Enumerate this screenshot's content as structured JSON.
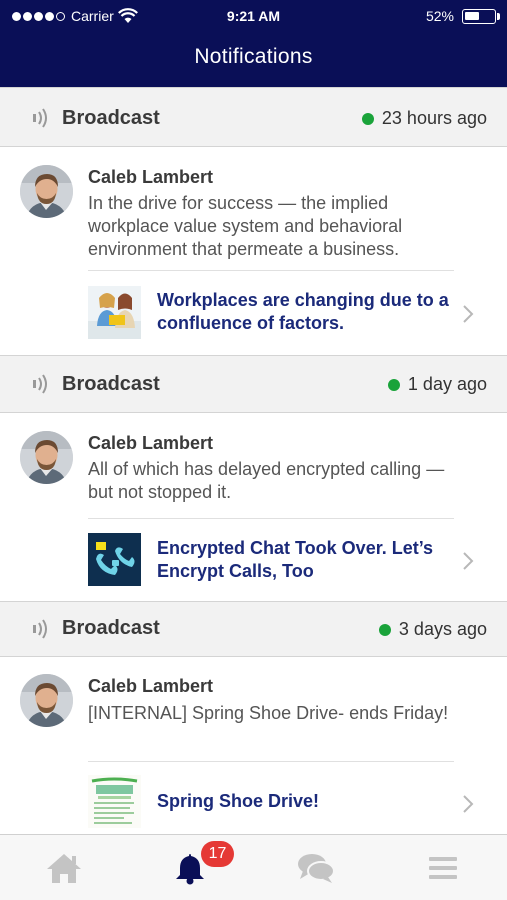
{
  "status_bar": {
    "carrier": "Carrier",
    "time": "9:21 AM",
    "battery_percent": "52%",
    "battery_level": 0.52,
    "signal_bars_filled": 4,
    "signal_bars_total": 5
  },
  "header": {
    "title": "Notifications"
  },
  "colors": {
    "header_bg": "#0a0f57",
    "accent_link": "#1b2a7a",
    "online_dot": "#1aa33a",
    "badge": "#e53935"
  },
  "notifications": [
    {
      "section_label": "Broadcast",
      "time_ago": "23 hours ago",
      "sender": "Caleb Lambert",
      "message": "In the drive for success — the implied workplace value system and behavioral environment that permeate a business.",
      "link_title": "Workplaces are changing due to a confluence of factors."
    },
    {
      "section_label": "Broadcast",
      "time_ago": "1 day ago",
      "sender": "Caleb Lambert",
      "message": "All of which has delayed encrypted calling — but not stopped it.",
      "link_title": "Encrypted Chat Took Over. Let’s Encrypt Calls, Too"
    },
    {
      "section_label": "Broadcast",
      "time_ago": "3 days ago",
      "sender": "Caleb Lambert",
      "message": "[INTERNAL] Spring Shoe Drive- ends Friday!",
      "link_title": "Spring Shoe Drive!"
    }
  ],
  "tab_bar": {
    "tabs": [
      {
        "icon": "home-icon",
        "active": false
      },
      {
        "icon": "bell-icon",
        "active": true,
        "badge": "17"
      },
      {
        "icon": "chat-bubbles-icon",
        "active": false
      },
      {
        "icon": "menu-icon",
        "active": false
      }
    ]
  }
}
